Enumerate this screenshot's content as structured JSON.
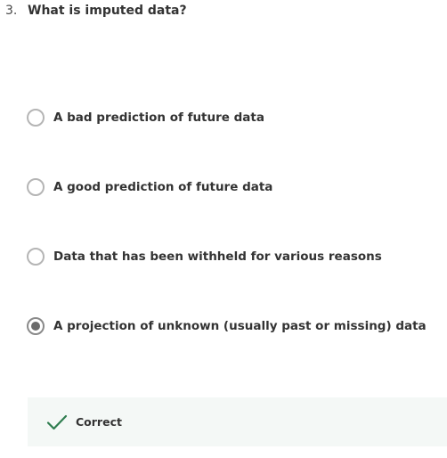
{
  "question": {
    "number": "3.",
    "text": "What is imputed data?"
  },
  "options": [
    {
      "label": "A bad prediction of future data",
      "selected": false
    },
    {
      "label": "A good prediction of future data",
      "selected": false
    },
    {
      "label": "Data that has been withheld for various reasons",
      "selected": false
    },
    {
      "label": "A projection of unknown (usually past or missing) data",
      "selected": true
    }
  ],
  "feedback": {
    "status": "Correct",
    "icon": "checkmark-icon",
    "icon_color": "#2e7d4f",
    "background": "#f4f8f6"
  }
}
